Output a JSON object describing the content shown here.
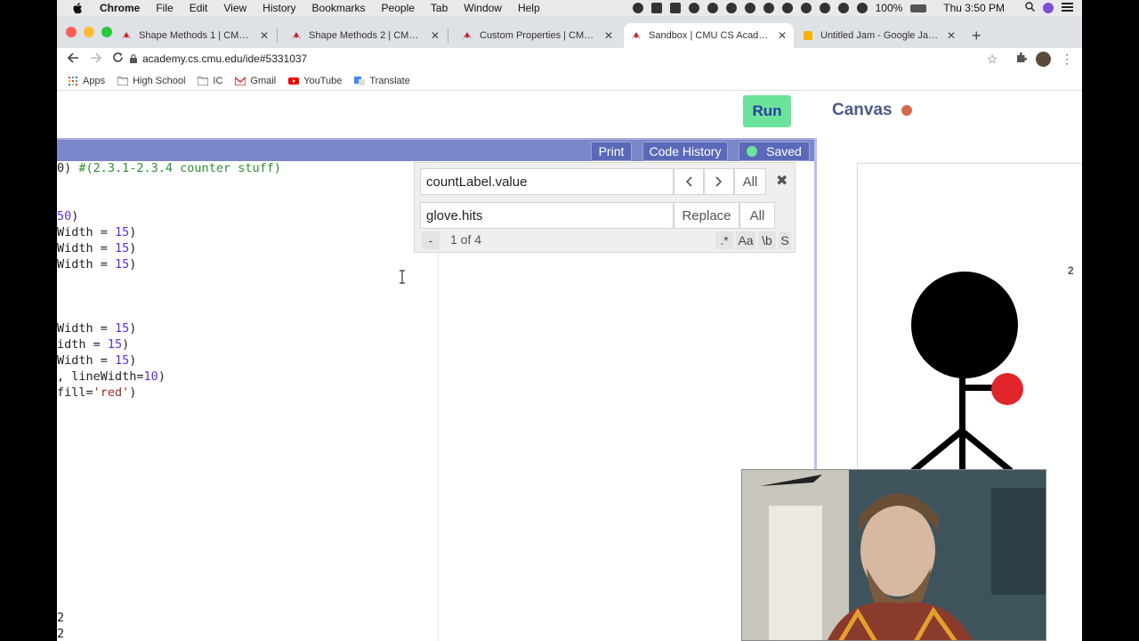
{
  "menubar": {
    "app": "Chrome",
    "items": [
      "File",
      "Edit",
      "View",
      "History",
      "Bookmarks",
      "People",
      "Tab",
      "Window",
      "Help"
    ],
    "battery": "100%",
    "clock": "Thu 3:50 PM"
  },
  "tabs": [
    {
      "title": "Shape Methods 1 | CMU CS Ac",
      "active": false
    },
    {
      "title": "Shape Methods 2 | CMU CS Ac",
      "active": false
    },
    {
      "title": "Custom Properties | CMU CS A",
      "active": false
    },
    {
      "title": "Sandbox | CMU CS Academy",
      "active": true
    },
    {
      "title": "Untitled Jam - Google Jamboa",
      "active": false
    }
  ],
  "address": {
    "url": "academy.cs.cmu.edu/ide#5331037"
  },
  "bookmarks": [
    "Apps",
    "High School",
    "IC",
    "Gmail",
    "YouTube",
    "Translate"
  ],
  "ide": {
    "run_label": "Run",
    "canvas_title": "Canvas",
    "print_label": "Print",
    "code_history_label": "Code History",
    "saved_label": "Saved"
  },
  "code": {
    "l1_a": "0) ",
    "l1_b": "#(2.3.1-2.3.4 counter stuff)",
    "l2_a": "50",
    "l2_b": ")",
    "l3_a": "Width = ",
    "l3_b": "15",
    "l3_c": ")",
    "l4_a": "Width = ",
    "l4_b": "15",
    "l4_c": ")",
    "l5_a": "Width = ",
    "l5_b": "15",
    "l5_c": ")",
    "l6_a": "Width = ",
    "l6_b": "15",
    "l6_c": ")",
    "l7_a": "idth = ",
    "l7_b": "15",
    "l7_c": ")",
    "l8_a": "Width = ",
    "l8_b": "15",
    "l8_c": ")",
    "l9_a": ", lineWidth=",
    "l9_b": "10",
    "l9_c": ")",
    "l10_a": "fill=",
    "l10_b": "'red'",
    "l10_c": ")",
    "out1": "2",
    "out2": "2"
  },
  "find": {
    "search_value": "countLabel.value",
    "replace_value": "glove.hits",
    "all_label": "All",
    "replace_label": "Replace",
    "replace_all_label": "All",
    "collapse_label": "-",
    "match_count": "1 of 4",
    "regex_label": ".*",
    "case_label": "Aa",
    "word_label": "\\b",
    "selection_label": "S"
  },
  "canvas": {
    "count_text": "2"
  }
}
